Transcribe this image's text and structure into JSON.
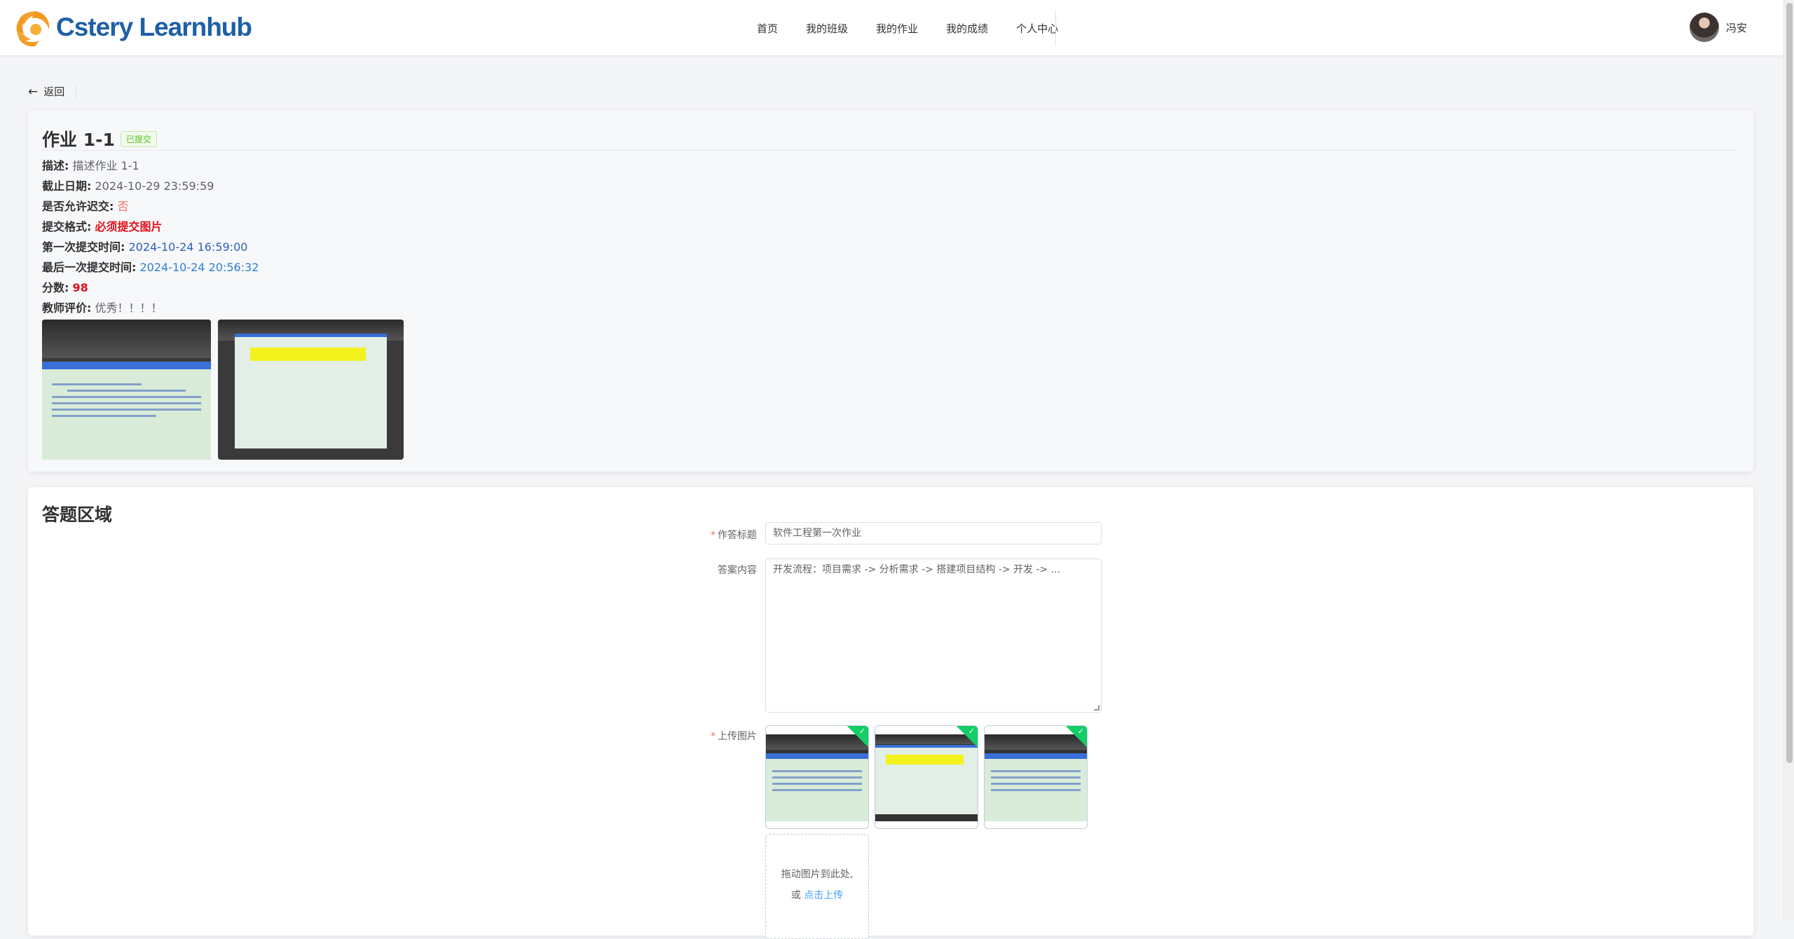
{
  "header": {
    "logo_text": "Cstery Learnhub",
    "nav": [
      "首页",
      "我的班级",
      "我的作业",
      "我的成绩",
      "个人中心"
    ],
    "user_name": "冯安"
  },
  "back_label": "返回",
  "assignment": {
    "title": "作业 1-1",
    "status": "已提交",
    "fields": {
      "desc_key": "描述:",
      "desc_val": "描述作业 1-1",
      "due_key": "截止日期:",
      "due_val": "2024-10-29 23:59:59",
      "late_key": "是否允许迟交:",
      "late_val": "否",
      "format_key": "提交格式:",
      "format_val": "必须提交图片",
      "first_key": "第一次提交时间:",
      "first_val": "2024-10-24 16:59:00",
      "last_key": "最后一次提交时间:",
      "last_val": "2024-10-24 20:56:32",
      "score_key": "分数:",
      "score_val": "98",
      "comment_key": "教师评价:",
      "comment_val": "优秀！！！！"
    }
  },
  "answer": {
    "section_title": "答题区域",
    "title_label": "作答标题",
    "title_value": "软件工程第一次作业",
    "content_label": "答案内容",
    "content_value": "开发流程：项目需求 -> 分析需求 -> 搭建项目结构 -> 开发 -> ...",
    "upload_label": "上传图片",
    "drop_text": "拖动图片到此处,",
    "drop_or": "或",
    "drop_link": "点击上传"
  },
  "colors": {
    "brand": "#1e5fa8",
    "logo_orange": "#f39a1e",
    "success": "#13ce66",
    "danger": "#e0101a",
    "link": "#409eff"
  }
}
